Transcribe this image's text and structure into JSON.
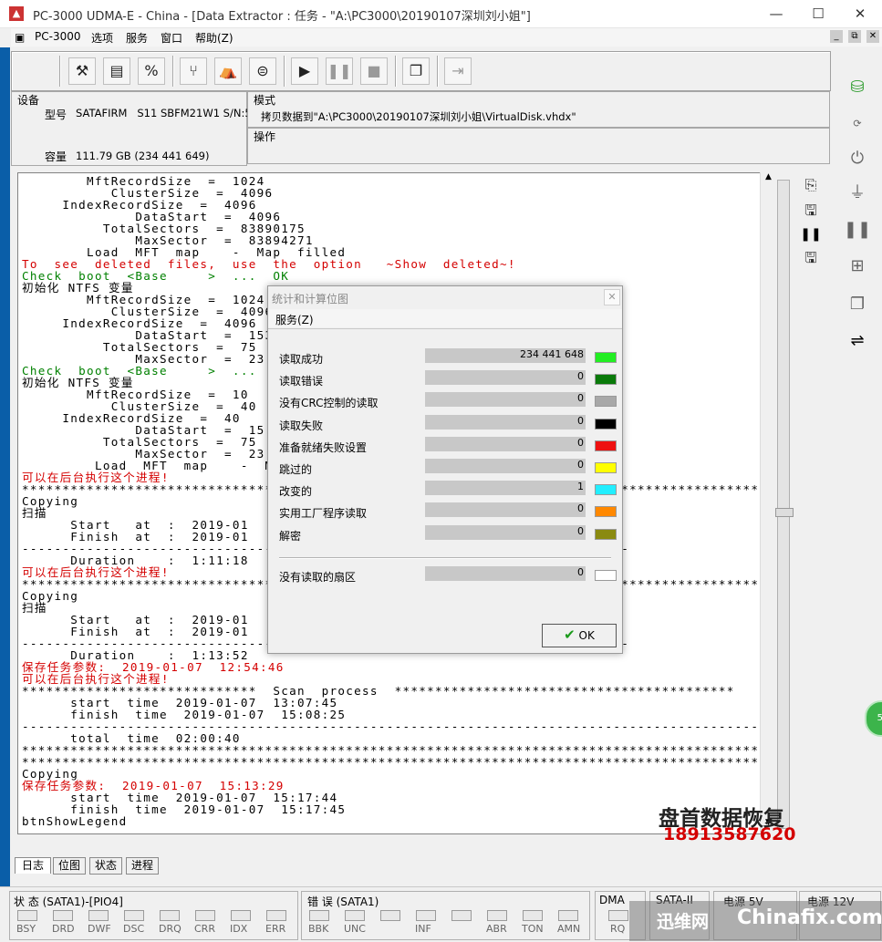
{
  "window": {
    "title": "PC-3000 UDMA-E - China - [Data Extractor : 任务 - \"A:\\PC3000\\20190107深圳刘小姐\"]",
    "minimize": "—",
    "maximize": "☐",
    "close": "✕"
  },
  "menu": {
    "items": [
      "PC-3000",
      "选项",
      "服务",
      "窗口",
      "帮助(Z)"
    ],
    "mdi_buttons": [
      "_",
      "⧉",
      "✕"
    ]
  },
  "info": {
    "device_label": "设备",
    "model_key": "型号",
    "model_value": "SATAFIRM   S11 SBFM21W1 S/N:500",
    "capacity_key": "容量",
    "capacity_value": "111.79 GB (234 441 649)",
    "mode_label": "模式",
    "mode_value": "拷贝数据到\"A:\\PC3000\\20190107深圳刘小姐\\VirtualDisk.vhdx\"",
    "operation_label": "操作"
  },
  "log": [
    {
      "t": "        MftRecordSize  =  1024",
      "c": "black"
    },
    {
      "t": "           ClusterSize  =  4096",
      "c": "black"
    },
    {
      "t": "     IndexRecordSize  =  4096",
      "c": "black"
    },
    {
      "t": "              DataStart  =  4096",
      "c": "black"
    },
    {
      "t": "          TotalSectors  =  83890175",
      "c": "black"
    },
    {
      "t": "              MaxSector  =  83894271",
      "c": "black"
    },
    {
      "t": "        Load  MFT  map    -  Map  filled",
      "c": "black"
    },
    {
      "t": "To  see  deleted  files,  use  the  option   ~Show  deleted~!",
      "c": "red"
    },
    {
      "t": "Check  boot  <Base     >  ...  OK",
      "c": "green"
    },
    {
      "t": "初始化 NTFS 变量",
      "c": "black"
    },
    {
      "t": "        MftRecordSize  =  1024",
      "c": "black"
    },
    {
      "t": "           ClusterSize  =  4096",
      "c": "black"
    },
    {
      "t": "     IndexRecordSize  =  4096",
      "c": "black"
    },
    {
      "t": "              DataStart  =  1536",
      "c": "black"
    },
    {
      "t": "          TotalSectors  =  75",
      "c": "black"
    },
    {
      "t": "              MaxSector  =  23",
      "c": "black"
    },
    {
      "t": "Check  boot  <Base     >  ...",
      "c": "green"
    },
    {
      "t": "初始化 NTFS 变量",
      "c": "black"
    },
    {
      "t": "        MftRecordSize  =  10",
      "c": "black"
    },
    {
      "t": "           ClusterSize  =  40",
      "c": "black"
    },
    {
      "t": "     IndexRecordSize  =  40",
      "c": "black"
    },
    {
      "t": "              DataStart  =  15",
      "c": "black"
    },
    {
      "t": "          TotalSectors  =  75",
      "c": "black"
    },
    {
      "t": "              MaxSector  =  23",
      "c": "black"
    },
    {
      "t": "         Load  MFT  map    -  Ma",
      "c": "black"
    },
    {
      "t": "可以在后台执行这个进程!",
      "c": "red"
    },
    {
      "t": "*************************************************************************************************************",
      "c": "black"
    },
    {
      "t": "Copying",
      "c": "black"
    },
    {
      "t": "扫描",
      "c": "black"
    },
    {
      "t": "      Start   at  :  2019-01",
      "c": "black"
    },
    {
      "t": "      Finish  at  :  2019-01",
      "c": "black"
    },
    {
      "t": "---------------------------------------------------------------------------",
      "c": "black"
    },
    {
      "t": "      Duration    :  1:11:18",
      "c": "black"
    },
    {
      "t": "可以在后台执行这个进程!",
      "c": "red"
    },
    {
      "t": "*************************************************************************************************************",
      "c": "black"
    },
    {
      "t": "Copying",
      "c": "black"
    },
    {
      "t": "扫描",
      "c": "black"
    },
    {
      "t": "      Start   at  :  2019-01",
      "c": "black"
    },
    {
      "t": "      Finish  at  :  2019-01",
      "c": "black"
    },
    {
      "t": "---------------------------------------------------------------------------",
      "c": "black"
    },
    {
      "t": "      Duration    :  1:13:52",
      "c": "black"
    },
    {
      "t": "保存任务参数:  2019-01-07  12:54:46",
      "c": "red"
    },
    {
      "t": "可以在后台执行这个进程!",
      "c": "red"
    },
    {
      "t": "*****************************  Scan  process  ******************************************",
      "c": "black"
    },
    {
      "t": "      start  time  2019-01-07  13:07:45",
      "c": "black"
    },
    {
      "t": "      finish  time  2019-01-07  15:08:25",
      "c": "black"
    },
    {
      "t": "-------------------------------------------------------------------------------------------------------------",
      "c": "black"
    },
    {
      "t": "      total  time  02:00:40",
      "c": "black"
    },
    {
      "t": "*************************************************************************************************************",
      "c": "black"
    },
    {
      "t": "*************************************************************************************************************",
      "c": "black"
    },
    {
      "t": "Copying",
      "c": "black"
    },
    {
      "t": "保存任务参数:  2019-01-07  15:13:29",
      "c": "red"
    },
    {
      "t": "      start  time  2019-01-07  15:17:44",
      "c": "black"
    },
    {
      "t": "      finish  time  2019-01-07  15:17:45",
      "c": "black"
    },
    {
      "t": "btnShowLegend",
      "c": "black"
    }
  ],
  "tabs": [
    "日志",
    "位图",
    "状态",
    "进程"
  ],
  "dialog": {
    "title": "统计和计算位图",
    "close": "✕",
    "menu": "服务(Z)",
    "rows": [
      {
        "label": "读取成功",
        "value": "234 441 648",
        "color": "#22ee22"
      },
      {
        "label": "读取错误",
        "value": "0",
        "color": "#0a7a0a"
      },
      {
        "label": "没有CRC控制的读取",
        "value": "0",
        "color": "#a8a8a8"
      },
      {
        "label": "读取失败",
        "value": "0",
        "color": "#000000"
      },
      {
        "label": "准备就绪失败设置",
        "value": "0",
        "color": "#ee1111"
      },
      {
        "label": "跳过的",
        "value": "0",
        "color": "#ffff00"
      },
      {
        "label": "改变的",
        "value": "1",
        "color": "#22eeff"
      },
      {
        "label": "实用工厂程序读取",
        "value": "0",
        "color": "#ff8800"
      },
      {
        "label": "解密",
        "value": "0",
        "color": "#8a8a10"
      }
    ],
    "unread_label": "没有读取的扇区",
    "unread_value": "0",
    "unread_color": "#ffffff",
    "ok_label": "OK"
  },
  "status": {
    "state_label": "状 态 (SATA1)-[PIO4]",
    "state_leds": [
      "BSY",
      "DRD",
      "DWF",
      "DSC",
      "DRQ",
      "CRR",
      "IDX",
      "ERR"
    ],
    "error_label": "错 误 (SATA1)",
    "error_leds": [
      "BBK",
      "UNC",
      "",
      "INF",
      "",
      "ABR",
      "TON",
      "AMN"
    ],
    "dma_label": "DMA",
    "dma_led": "RQ",
    "sata_label": "SATA-II",
    "power5_label": "电源 5V",
    "power12_label": "电源 12V"
  },
  "watermark": {
    "line1": "盘首数据恢复",
    "line2": "18913587620",
    "brand1": "迅维网",
    "brand2": "Chinafix.com"
  },
  "bubble": "58"
}
